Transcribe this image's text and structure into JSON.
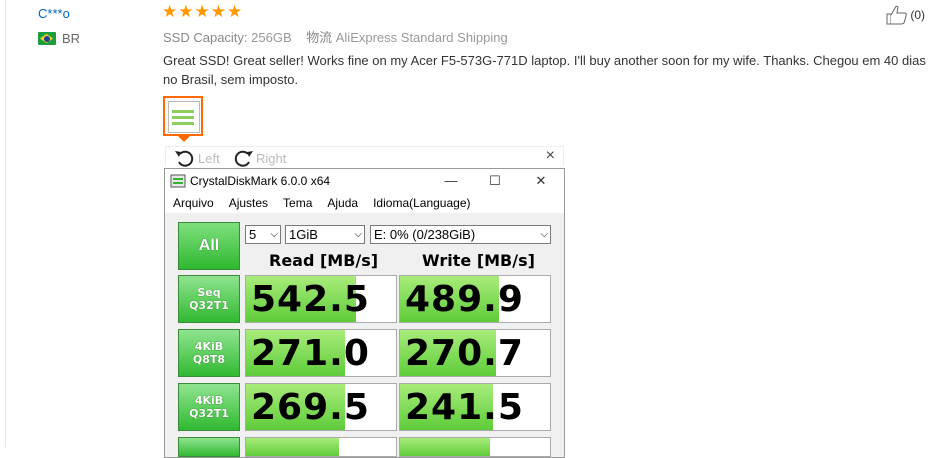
{
  "review": {
    "user": "C***o",
    "country": "BR",
    "stars": [
      "★",
      "★",
      "★",
      "★",
      "★"
    ],
    "helpful_count": "(0)",
    "spec_label": "SSD Capacity:",
    "spec_value": "256GB",
    "shipping_label": "物流",
    "shipping_value": "AliExpress Standard Shipping",
    "text": "Great SSD! Great seller! Works fine on my Acer F5-573G-771D laptop. I'll buy another soon for my wife. Thanks. Chegou em 40 dias no Brasil, sem imposto."
  },
  "viewer": {
    "rotate_left": "Left",
    "rotate_right": "Right",
    "close": "×"
  },
  "crystaldisk": {
    "title": "CrystalDiskMark 6.0.0 x64",
    "window_buttons": {
      "minimize": "—",
      "maximize": "☐",
      "close": "✕"
    },
    "menu": [
      "Arquivo",
      "Ajustes",
      "Tema",
      "Ajuda",
      "Idioma(Language)"
    ],
    "all_label": "All",
    "count_select": "5",
    "size_select": "1GiB",
    "drive_select": "E: 0% (0/238GiB)",
    "read_header": "Read [MB/s]",
    "write_header": "Write [MB/s]",
    "rows": [
      {
        "line1": "Seq",
        "line2": "Q32T1",
        "read": "542.5",
        "write": "489.9",
        "read_fill": 0.73,
        "write_fill": 0.66
      },
      {
        "line1": "4KiB",
        "line2": "Q8T8",
        "read": "271.0",
        "write": "270.7",
        "read_fill": 0.66,
        "write_fill": 0.64
      },
      {
        "line1": "4KiB",
        "line2": "Q32T1",
        "read": "269.5",
        "write": "241.5",
        "read_fill": 0.66,
        "write_fill": 0.62
      }
    ]
  },
  "colors": {
    "star": "#ff9800",
    "link": "#0066cc",
    "thumb_border": "#ff6a00",
    "cdm_green": "#2fb82f"
  }
}
